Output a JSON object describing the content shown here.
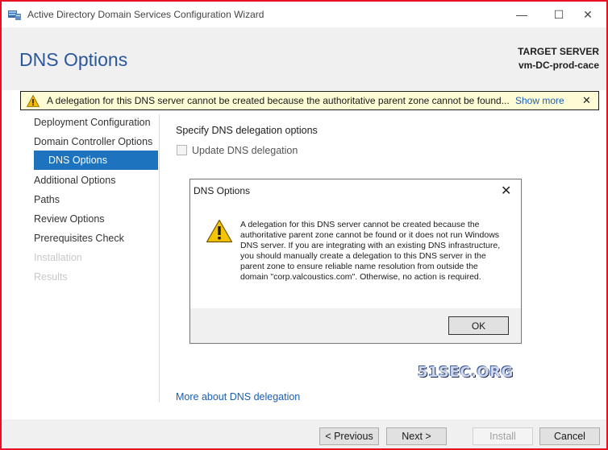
{
  "window": {
    "title": "Active Directory Domain Services Configuration Wizard",
    "minimize_glyph": "—",
    "maximize_glyph": "☐",
    "close_glyph": "✕",
    "border_color": "#e81123"
  },
  "header": {
    "page_title": "DNS Options",
    "target_server_label": "TARGET SERVER",
    "target_server_value": "vm-DC-prod-cace"
  },
  "warning_bar": {
    "text": "A delegation for this DNS server cannot be created because the authoritative parent zone cannot be found...",
    "show_more": "Show more",
    "close_glyph": "✕",
    "icon": "warning-icon"
  },
  "nav": {
    "items": [
      {
        "label": "Deployment Configuration",
        "state": "normal"
      },
      {
        "label": "Domain Controller Options",
        "state": "normal"
      },
      {
        "label": "DNS Options",
        "state": "selected"
      },
      {
        "label": "Additional Options",
        "state": "normal"
      },
      {
        "label": "Paths",
        "state": "normal"
      },
      {
        "label": "Review Options",
        "state": "normal"
      },
      {
        "label": "Prerequisites Check",
        "state": "normal"
      },
      {
        "label": "Installation",
        "state": "disabled"
      },
      {
        "label": "Results",
        "state": "disabled"
      }
    ]
  },
  "main": {
    "specify_label": "Specify DNS delegation options",
    "update_checkbox_label": "Update DNS delegation",
    "update_checkbox_checked": false,
    "more_link": "More about DNS delegation"
  },
  "dialog": {
    "title": "DNS Options",
    "close_glyph": "✕",
    "message": "A delegation for this DNS server cannot be created because the authoritative parent zone cannot be found or it does not run Windows DNS server. If you are integrating with an existing DNS infrastructure, you should manually create a delegation to this DNS server in the parent zone to ensure reliable name resolution from outside the domain \"corp.valcoustics.com\". Otherwise, no action is required.",
    "ok_label": "OK",
    "icon": "warning-icon"
  },
  "watermark": "51SEC.ORG",
  "footer": {
    "previous_label": "< Previous",
    "next_label": "Next >",
    "install_label": "Install",
    "cancel_label": "Cancel"
  },
  "colors": {
    "accent": "#1e73be",
    "title_blue": "#2b579a",
    "warning_bg": "#fdfcd4",
    "link": "#1a5fb4"
  }
}
